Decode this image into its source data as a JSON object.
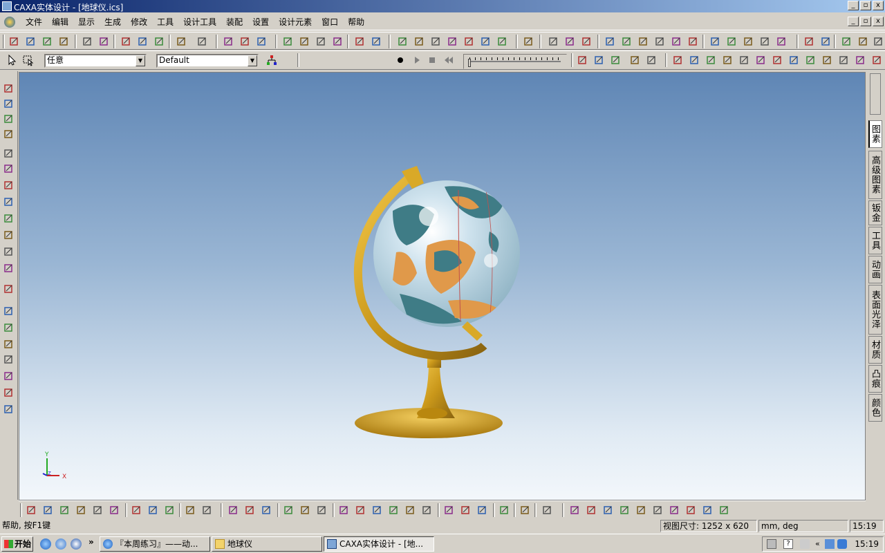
{
  "window": {
    "title": "CAXA实体设计 - [地球仪.ics]",
    "min": "_",
    "max": "▫",
    "close": "x"
  },
  "menu": {
    "items": [
      "文件",
      "编辑",
      "显示",
      "生成",
      "修改",
      "工具",
      "设计工具",
      "装配",
      "设置",
      "设计元素",
      "窗口",
      "帮助"
    ]
  },
  "toolbar2": {
    "select_filter_value": "任意",
    "style_value": "Default"
  },
  "right_tabs": [
    "图素",
    "高级图素",
    "钣金",
    "工具",
    "动画",
    "表面光泽",
    "材质",
    "凸痕",
    "颜色"
  ],
  "viewport": {
    "axis_x": "X",
    "axis_y": "Y",
    "axis_z": "Z"
  },
  "status": {
    "help": "帮助, 按F1键",
    "view_size": "视图尺寸: 1252 x  620",
    "units": "mm, deg",
    "time": "15:19"
  },
  "taskbar": {
    "start": "开始",
    "chevron": "»",
    "tasks": [
      {
        "label": "『本周练习』——动..."
      },
      {
        "label": "地球仪"
      },
      {
        "label": "CAXA实体设计 - [地..."
      }
    ],
    "clock": "15:19"
  },
  "colors": {
    "title_gradient_start": "#0a246a",
    "globe_ocean": "#3f7c86",
    "globe_land": "#e0994a",
    "stand_gold": "#d4a017"
  }
}
